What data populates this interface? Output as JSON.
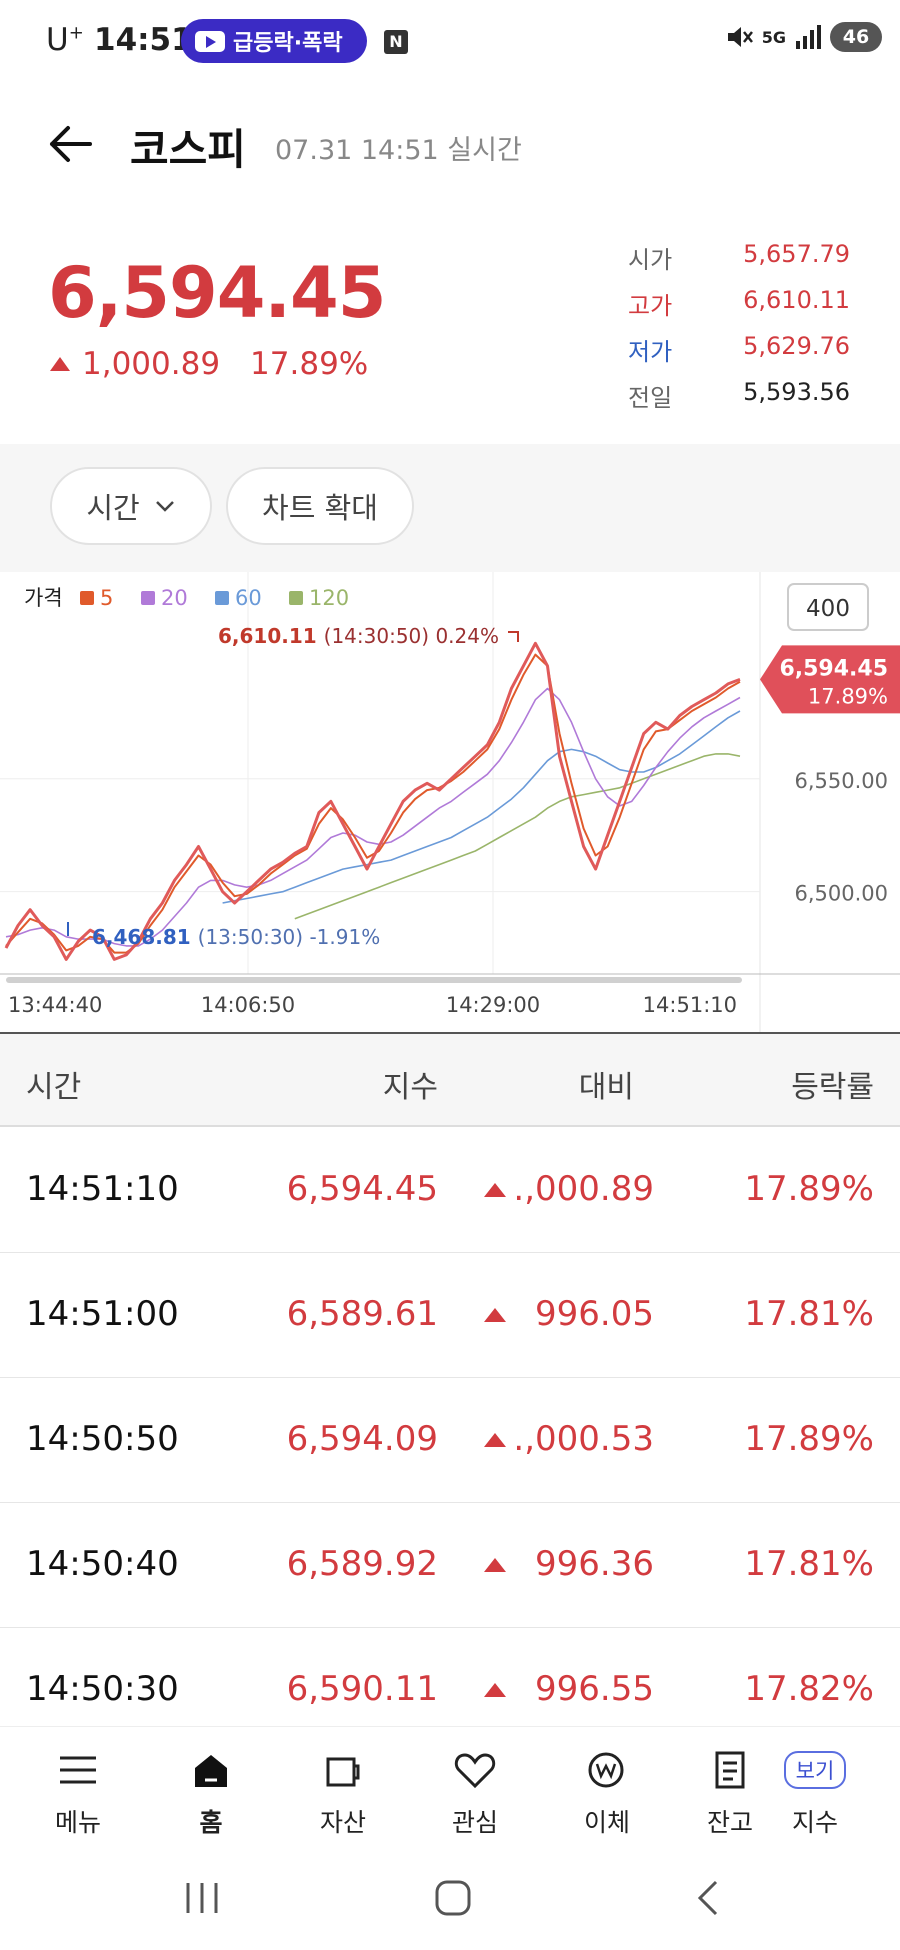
{
  "status_bar": {
    "carrier": "U",
    "carrier_sup": "+",
    "time": "14:51",
    "notification": "급등락·폭락",
    "n_badge": "N",
    "network": "5G",
    "battery": "46"
  },
  "header": {
    "title": "코스피",
    "subtitle": "07.31 14:51 실시간"
  },
  "price": {
    "current": "6,594.45",
    "change": "1,000.89",
    "change_pct": "17.89%"
  },
  "ohlc": [
    {
      "label": "시가",
      "value": "5,657.79",
      "label_color": "#666666",
      "value_color": "#d23b3f"
    },
    {
      "label": "고가",
      "value": "6,610.11",
      "label_color": "#d23b3f",
      "value_color": "#d23b3f"
    },
    {
      "label": "저가",
      "value": "5,629.76",
      "label_color": "#3060c0",
      "value_color": "#d23b3f"
    },
    {
      "label": "전일",
      "value": "5,593.56",
      "label_color": "#666666",
      "value_color": "#222222"
    }
  ],
  "controls": {
    "time_button": "시간",
    "zoom_button": "차트 확대"
  },
  "chart_data": {
    "type": "line",
    "legend_title": "가격",
    "legend": [
      {
        "name": "5",
        "color": "#e05a2b"
      },
      {
        "name": "20",
        "color": "#b07ad8"
      },
      {
        "name": "60",
        "color": "#6a9ad8"
      },
      {
        "name": "120",
        "color": "#9ab56a"
      }
    ],
    "ylim": [
      6460,
      6615
    ],
    "y_ticks": [
      6550,
      6500
    ],
    "y_tick_labels": [
      "6,550.00",
      "6,500.00"
    ],
    "x_tick_labels": [
      "13:44:40",
      "14:06:50",
      "14:29:00",
      "14:51:10"
    ],
    "zoom_box": "400",
    "current_tag": {
      "value": "6,594.45",
      "pct": "17.89%"
    },
    "high_annotation": {
      "value": "6,610.11",
      "detail": "(14:30:50) 0.24%"
    },
    "low_annotation": {
      "value": "6,468.81",
      "detail": "(13:50:30) -1.91%"
    },
    "series": [
      {
        "name": "price",
        "color": "#e05a5a",
        "values": [
          6475,
          6485,
          6492,
          6485,
          6480,
          6470,
          6478,
          6483,
          6480,
          6470,
          6472,
          6478,
          6488,
          6495,
          6505,
          6512,
          6520,
          6510,
          6500,
          6495,
          6500,
          6505,
          6510,
          6513,
          6517,
          6520,
          6535,
          6540,
          6530,
          6520,
          6510,
          6520,
          6530,
          6540,
          6545,
          6548,
          6545,
          6550,
          6555,
          6560,
          6565,
          6575,
          6590,
          6600,
          6610,
          6600,
          6560,
          6540,
          6520,
          6510,
          6525,
          6540,
          6555,
          6570,
          6575,
          6572,
          6578,
          6582,
          6585,
          6588,
          6592,
          6594
        ]
      },
      {
        "name": "5",
        "color": "#e05a2b",
        "values": [
          6476,
          6482,
          6488,
          6486,
          6481,
          6474,
          6476,
          6480,
          6479,
          6473,
          6473,
          6477,
          6485,
          6492,
          6502,
          6509,
          6516,
          6512,
          6504,
          6498,
          6499,
          6503,
          6508,
          6512,
          6516,
          6519,
          6530,
          6537,
          6532,
          6524,
          6515,
          6518,
          6526,
          6535,
          6541,
          6545,
          6546,
          6549,
          6553,
          6558,
          6563,
          6572,
          6585,
          6596,
          6605,
          6600,
          6570,
          6548,
          6528,
          6516,
          6520,
          6533,
          6548,
          6563,
          6571,
          6572,
          6576,
          6580,
          6583,
          6586,
          6590,
          6593
        ]
      },
      {
        "name": "20",
        "color": "#b07ad8",
        "values": [
          6480,
          6481,
          6483,
          6484,
          6483,
          6480,
          6479,
          6479,
          6479,
          6477,
          6476,
          6476,
          6479,
          6483,
          6489,
          6495,
          6502,
          6505,
          6505,
          6503,
          6502,
          6503,
          6505,
          6508,
          6511,
          6514,
          6519,
          6524,
          6526,
          6525,
          6522,
          6521,
          6522,
          6525,
          6529,
          6533,
          6537,
          6540,
          6544,
          6548,
          6552,
          6558,
          6566,
          6575,
          6585,
          6590,
          6585,
          6575,
          6562,
          6550,
          6542,
          6538,
          6540,
          6547,
          6555,
          6562,
          6568,
          6573,
          6577,
          6580,
          6583,
          6586
        ]
      },
      {
        "name": "60",
        "color": "#6a9ad8",
        "values": [
          null,
          null,
          null,
          null,
          null,
          null,
          null,
          null,
          null,
          null,
          null,
          null,
          null,
          null,
          null,
          null,
          null,
          null,
          6495,
          6496,
          6497,
          6498,
          6499,
          6500,
          6502,
          6504,
          6506,
          6508,
          6510,
          6511,
          6512,
          6513,
          6514,
          6516,
          6518,
          6520,
          6522,
          6524,
          6527,
          6530,
          6533,
          6537,
          6541,
          6546,
          6552,
          6558,
          6562,
          6563,
          6562,
          6560,
          6557,
          6554,
          6553,
          6553,
          6555,
          6558,
          6561,
          6565,
          6569,
          6573,
          6577,
          6580
        ]
      },
      {
        "name": "120",
        "color": "#9ab56a",
        "values": [
          null,
          null,
          null,
          null,
          null,
          null,
          null,
          null,
          null,
          null,
          null,
          null,
          null,
          null,
          null,
          null,
          null,
          null,
          null,
          null,
          null,
          null,
          null,
          null,
          6488,
          6490,
          6492,
          6494,
          6496,
          6498,
          6500,
          6502,
          6504,
          6506,
          6508,
          6510,
          6512,
          6514,
          6516,
          6518,
          6521,
          6524,
          6527,
          6530,
          6533,
          6537,
          6540,
          6542,
          6543,
          6544,
          6545,
          6546,
          6548,
          6550,
          6552,
          6554,
          6556,
          6558,
          6560,
          6561,
          6561,
          6560
        ]
      }
    ]
  },
  "table": {
    "headers": [
      "시간",
      "지수",
      "대비",
      "등락률"
    ],
    "rows": [
      {
        "time": "14:51:10",
        "index": "6,594.45",
        "diff": ".,000.89",
        "rate": "17.89%"
      },
      {
        "time": "14:51:00",
        "index": "6,589.61",
        "diff": "996.05",
        "rate": "17.81%"
      },
      {
        "time": "14:50:50",
        "index": "6,594.09",
        "diff": ".,000.53",
        "rate": "17.89%"
      },
      {
        "time": "14:50:40",
        "index": "6,589.92",
        "diff": "996.36",
        "rate": "17.81%"
      },
      {
        "time": "14:50:30",
        "index": "6,590.11",
        "diff": "996.55",
        "rate": "17.82%"
      }
    ]
  },
  "bottom_nav": {
    "items": [
      "메뉴",
      "홈",
      "자산",
      "관심",
      "이체",
      "잔고",
      "지수"
    ],
    "view_badge": "보기"
  }
}
